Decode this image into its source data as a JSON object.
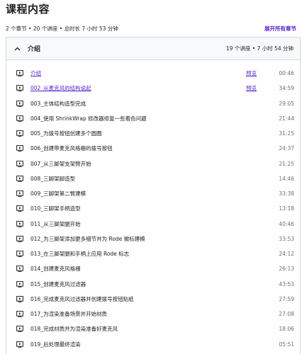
{
  "page_title": "课程内容",
  "summary": "2 个章节 • 20 个讲座 • 总时长 7 小时 53 分钟",
  "expand_all": "展开所有章节",
  "section": {
    "title": "介绍",
    "meta": "19 个讲座 • 7 小时 54 分钟",
    "expanded": true
  },
  "icons": {
    "chevron": "chevron-up-icon",
    "lecture": "video-icon"
  },
  "colors": {
    "link": "#5624d0",
    "border": "#d1d7dc",
    "header_bg": "#f7f9fa",
    "text": "#1c1d1f",
    "muted": "#6a6f73"
  },
  "lectures": [
    {
      "title": "介绍",
      "preview": "预览",
      "duration": "00:46"
    },
    {
      "title": "002_从麦克风的结构说起",
      "preview": "预览",
      "duration": "34:59"
    },
    {
      "title": "003_主体结构造型完成",
      "preview": "",
      "duration": "29:05"
    },
    {
      "title": "004_使用 ShrinkWrap 修改器修复一些着色问题",
      "preview": "",
      "duration": "21:44"
    },
    {
      "title": "005_为拨号按钮创建多个圆圈",
      "preview": "",
      "duration": "31:25"
    },
    {
      "title": "006_创建带麦克风格栅的拨号按钮",
      "preview": "",
      "duration": "24:37"
    },
    {
      "title": "007_从三脚架支架臂开始",
      "preview": "",
      "duration": "21:25"
    },
    {
      "title": "008_三脚架脚造型",
      "preview": "",
      "duration": "14:46"
    },
    {
      "title": "009_三脚架第二臂建模",
      "preview": "",
      "duration": "33:38"
    },
    {
      "title": "010_三脚架手柄造型",
      "preview": "",
      "duration": "13:18"
    },
    {
      "title": "011_从三脚架腿开始",
      "preview": "",
      "duration": "40:46"
    },
    {
      "title": "012_为三脚架添加更多细节并为 Rode 徽标建模",
      "preview": "",
      "duration": "33:53"
    },
    {
      "title": "013_在三脚架腿和手柄上应用 Rode 标志",
      "preview": "",
      "duration": "24:12"
    },
    {
      "title": "014_创建麦克风格栅",
      "preview": "",
      "duration": "26:13"
    },
    {
      "title": "015_创建麦克风过滤器",
      "preview": "",
      "duration": "43:53"
    },
    {
      "title": "016_完成麦克风过滤器并创建拨号按钮贴纸",
      "preview": "",
      "duration": "27:59"
    },
    {
      "title": "017_为渲染准备场景并开始材质",
      "preview": "",
      "duration": "27:08"
    },
    {
      "title": "018_完成材质并为渲染准备好麦克风",
      "preview": "",
      "duration": "18:06"
    },
    {
      "title": "019_后处理最终渲染",
      "preview": "",
      "duration": "05:51"
    }
  ]
}
